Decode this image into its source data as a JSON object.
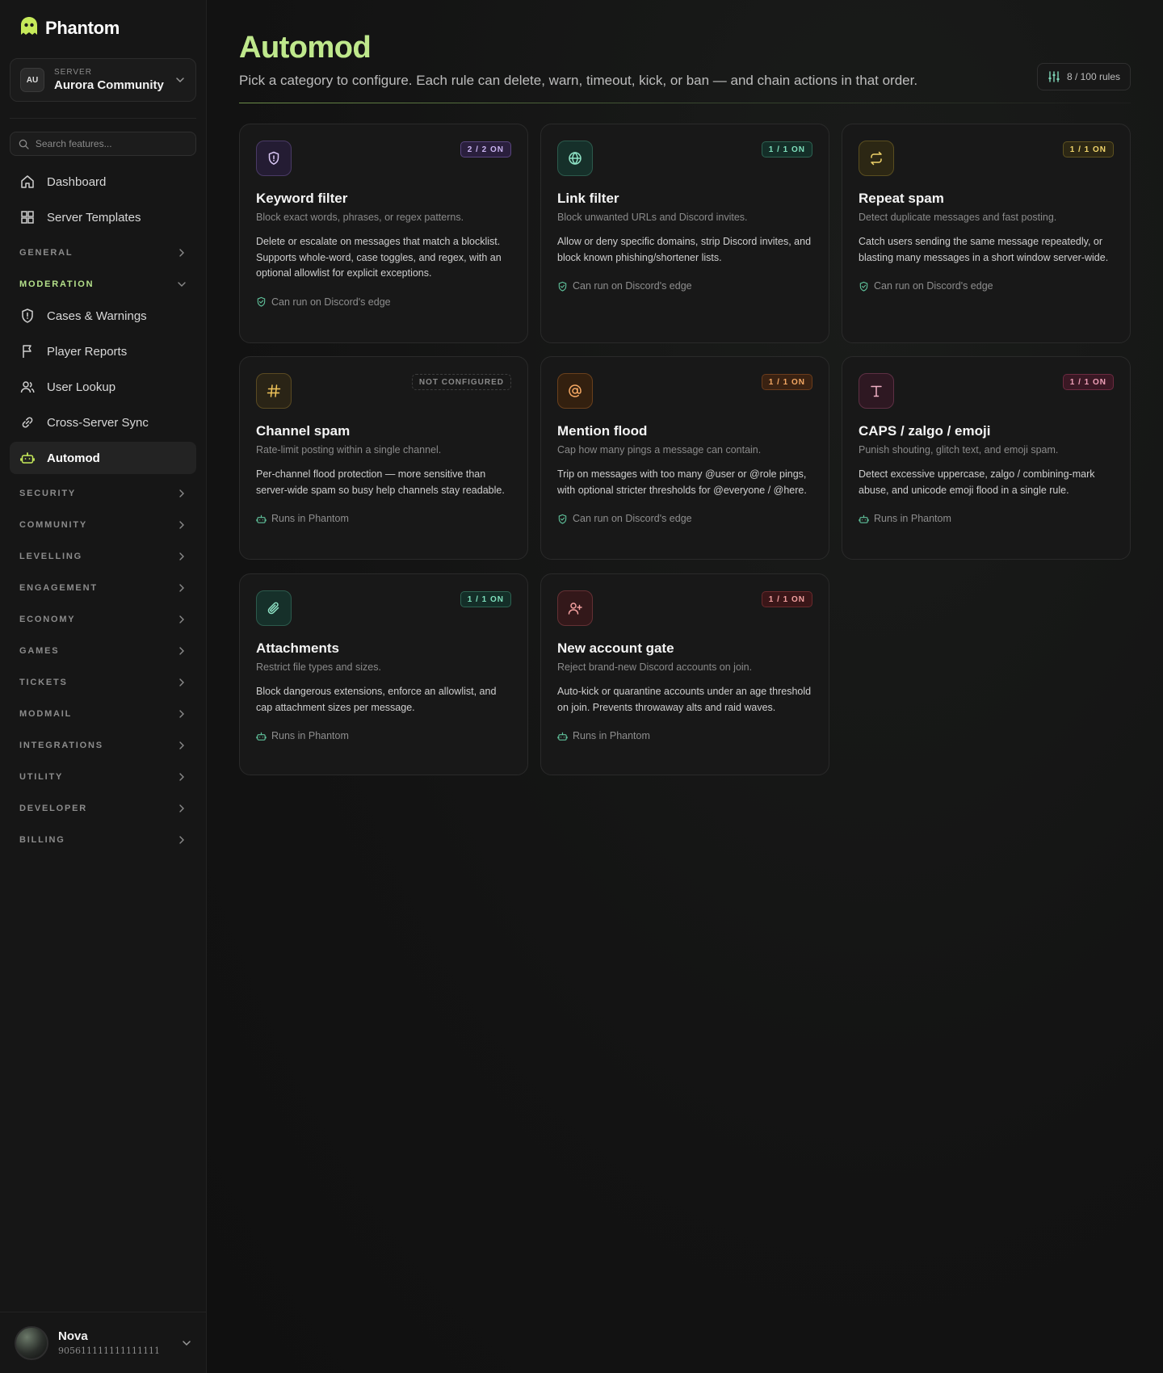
{
  "brand": {
    "name": "Phantom"
  },
  "server": {
    "label": "SERVER",
    "initials": "AU",
    "name": "Aurora Community"
  },
  "search": {
    "placeholder": "Search features..."
  },
  "nav": {
    "top": [
      {
        "label": "Dashboard",
        "icon": "home-icon"
      },
      {
        "label": "Server Templates",
        "icon": "grid-icon"
      }
    ],
    "general": "GENERAL",
    "moderation": "MODERATION",
    "moderation_items": [
      {
        "label": "Cases & Warnings",
        "icon": "shield-alert-icon"
      },
      {
        "label": "Player Reports",
        "icon": "flag-icon"
      },
      {
        "label": "User Lookup",
        "icon": "users-icon"
      },
      {
        "label": "Cross-Server Sync",
        "icon": "link-icon"
      },
      {
        "label": "Automod",
        "icon": "robot-icon"
      }
    ],
    "sections": [
      "SECURITY",
      "COMMUNITY",
      "LEVELLING",
      "ENGAGEMENT",
      "ECONOMY",
      "GAMES",
      "TICKETS",
      "MODMAIL",
      "INTEGRATIONS",
      "UTILITY",
      "DEVELOPER",
      "BILLING"
    ]
  },
  "user": {
    "name": "Nova",
    "id": "905611111111111111"
  },
  "page": {
    "title": "Automod",
    "subtitle": "Pick a category to configure. Each rule can delete, warn, timeout, kick, or ban — and chain actions in that order.",
    "rule_count": "8 / 100 rules"
  },
  "cards": [
    {
      "title": "Keyword filter",
      "subtitle": "Block exact words, phrases, or regex patterns.",
      "desc": "Delete or escalate on messages that match a blocklist. Supports whole-word, case toggles, and regex, with an optional allowlist for explicit exceptions.",
      "badge": "2 / 2 ON",
      "foot": "Can run on Discord's edge",
      "icon": "shield-icon"
    },
    {
      "title": "Link filter",
      "subtitle": "Block unwanted URLs and Discord invites.",
      "desc": "Allow or deny specific domains, strip Discord invites, and block known phishing/shortener lists.",
      "badge": "1 / 1 ON",
      "foot": "Can run on Discord's edge",
      "icon": "globe-icon"
    },
    {
      "title": "Repeat spam",
      "subtitle": "Detect duplicate messages and fast posting.",
      "desc": "Catch users sending the same message repeatedly, or blasting many messages in a short window server-wide.",
      "badge": "1 / 1 ON",
      "foot": "Can run on Discord's edge",
      "icon": "repeat-icon"
    },
    {
      "title": "Channel spam",
      "subtitle": "Rate-limit posting within a single channel.",
      "desc": "Per-channel flood protection — more sensitive than server-wide spam so busy help channels stay readable.",
      "badge": "NOT CONFIGURED",
      "foot": "Runs in Phantom",
      "icon": "hash-icon"
    },
    {
      "title": "Mention flood",
      "subtitle": "Cap how many pings a message can contain.",
      "desc": "Trip on messages with too many @user or @role pings, with optional stricter thresholds for @everyone / @here.",
      "badge": "1 / 1 ON",
      "foot": "Can run on Discord's edge",
      "icon": "at-sign-icon"
    },
    {
      "title": "CAPS / zalgo / emoji",
      "subtitle": "Punish shouting, glitch text, and emoji spam.",
      "desc": "Detect excessive uppercase, zalgo / combining-mark abuse, and unicode emoji flood in a single rule.",
      "badge": "1 / 1 ON",
      "foot": "Runs in Phantom",
      "icon": "type-icon"
    },
    {
      "title": "Attachments",
      "subtitle": "Restrict file types and sizes.",
      "desc": "Block dangerous extensions, enforce an allowlist, and cap attachment sizes per message.",
      "badge": "1 / 1 ON",
      "foot": "Runs in Phantom",
      "icon": "paperclip-icon"
    },
    {
      "title": "New account gate",
      "subtitle": "Reject brand-new Discord accounts on join.",
      "desc": "Auto-kick or quarantine accounts under an age threshold on join. Prevents throwaway alts and raid waves.",
      "badge": "1 / 1 ON",
      "foot": "Runs in Phantom",
      "icon": "user-plus-icon"
    }
  ]
}
